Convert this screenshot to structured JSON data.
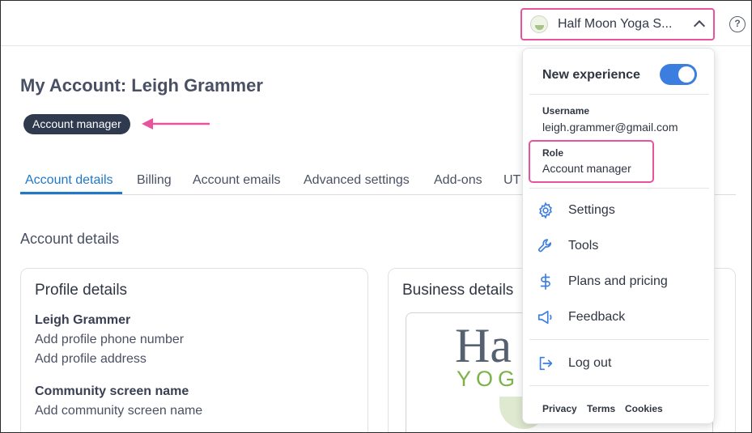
{
  "header": {
    "account_name": "Half Moon Yoga S...",
    "help_glyph": "?",
    "icons": [
      "account-logo-icon",
      "chevron-up-icon",
      "help-icon"
    ]
  },
  "page": {
    "title": "My Account: Leigh Grammer",
    "role_badge": "Account manager"
  },
  "tabs": [
    {
      "label": "Account details",
      "active": true
    },
    {
      "label": "Billing"
    },
    {
      "label": "Account emails"
    },
    {
      "label": "Advanced settings"
    },
    {
      "label": "Add-ons"
    },
    {
      "label": "UT"
    }
  ],
  "main": {
    "section_heading": "Account details",
    "profile_card": {
      "title": "Profile details",
      "name": "Leigh Grammer",
      "phone_prompt": "Add profile phone number",
      "address_prompt": "Add profile address",
      "community_heading": "Community screen name",
      "community_prompt": "Add community screen name"
    },
    "business_card": {
      "title": "Business details",
      "logo_text_top": "Ha",
      "logo_text_bottom": "YOG"
    }
  },
  "dropdown": {
    "new_experience_label": "New experience",
    "new_experience_on": true,
    "username_label": "Username",
    "username_value": "leigh.grammer@gmail.com",
    "role_label": "Role",
    "role_value": "Account manager",
    "menu": [
      {
        "label": "Settings",
        "icon": "gear-icon"
      },
      {
        "label": "Tools",
        "icon": "wrench-icon"
      },
      {
        "label": "Plans and pricing",
        "icon": "dollar-icon"
      },
      {
        "label": "Feedback",
        "icon": "megaphone-icon"
      }
    ],
    "logout_label": "Log out",
    "footer": [
      "Privacy",
      "Terms",
      "Cookies"
    ]
  },
  "colors": {
    "accent_blue": "#1f78c8",
    "highlight_pink": "#e9529c",
    "badge_dark": "#2f3a4f",
    "toggle_blue": "#3b7ee0"
  }
}
